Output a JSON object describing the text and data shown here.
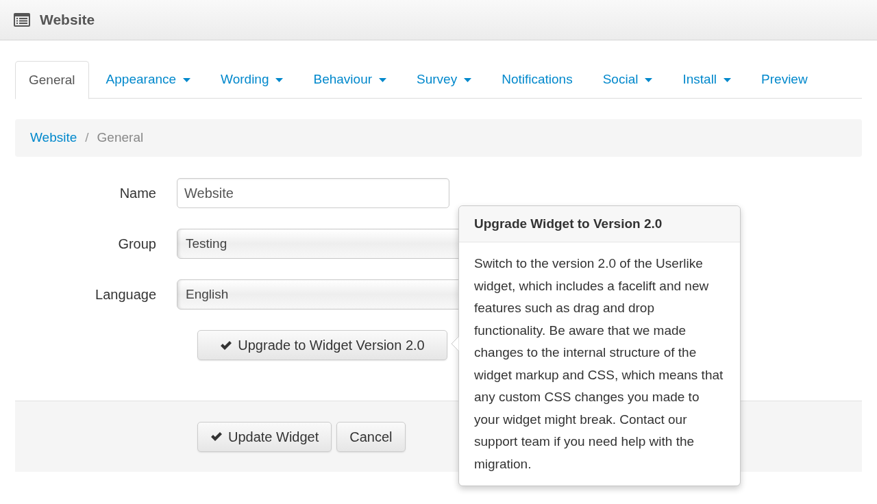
{
  "header": {
    "title": "Website"
  },
  "tabs": [
    {
      "label": "General",
      "selected": true,
      "dropdown": false
    },
    {
      "label": "Appearance",
      "selected": false,
      "dropdown": true
    },
    {
      "label": "Wording",
      "selected": false,
      "dropdown": true
    },
    {
      "label": "Behaviour",
      "selected": false,
      "dropdown": true
    },
    {
      "label": "Survey",
      "selected": false,
      "dropdown": true
    },
    {
      "label": "Notifications",
      "selected": false,
      "dropdown": false
    },
    {
      "label": "Social",
      "selected": false,
      "dropdown": true
    },
    {
      "label": "Install",
      "selected": false,
      "dropdown": true
    },
    {
      "label": "Preview",
      "selected": false,
      "dropdown": false
    }
  ],
  "breadcrumb": {
    "items": [
      "Website",
      "General"
    ],
    "separator": "/"
  },
  "form": {
    "fields": [
      {
        "kind": "text",
        "label": "Name",
        "value": "Website"
      },
      {
        "kind": "select",
        "label": "Group",
        "value": "Testing"
      },
      {
        "kind": "select",
        "label": "Language",
        "value": "English"
      }
    ],
    "upgrade_button": "Upgrade to Widget Version 2.0"
  },
  "footer": {
    "buttons": [
      {
        "label": "Update Widget",
        "icon": true
      },
      {
        "label": "Cancel",
        "icon": false
      }
    ]
  },
  "popover": {
    "title": "Upgrade Widget to Version 2.0",
    "body": "Switch to the version 2.0 of the Userlike widget, which includes a facelift and new features such as drag and drop functionality. Be aware that we made changes to the internal structure of the widget markup and CSS, which means that any custom CSS changes you made to your widget might break. Contact our support team if you need help with the migration."
  }
}
